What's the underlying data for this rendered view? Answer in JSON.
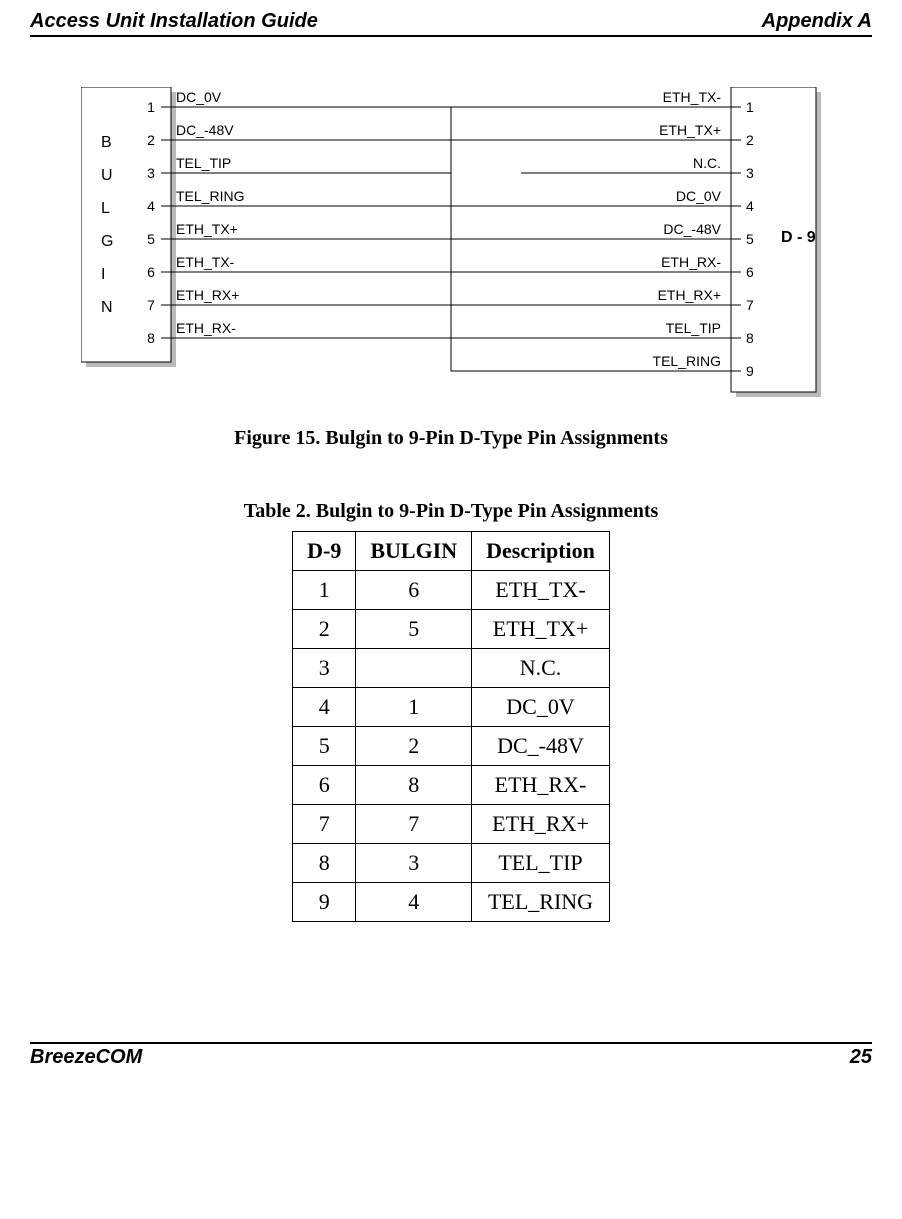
{
  "header": {
    "left": "Access Unit Installation Guide",
    "right": "Appendix A"
  },
  "footer": {
    "left": "BreezeCOM",
    "right": "25"
  },
  "diagram": {
    "left_label_letters": [
      "B",
      "U",
      "L",
      "G",
      "I",
      "N"
    ],
    "right_label": "D - 9",
    "left_pins": [
      {
        "num": "1",
        "label": "DC_0V"
      },
      {
        "num": "2",
        "label": "DC_-48V"
      },
      {
        "num": "3",
        "label": "TEL_TIP"
      },
      {
        "num": "4",
        "label": "TEL_RING"
      },
      {
        "num": "5",
        "label": "ETH_TX+"
      },
      {
        "num": "6",
        "label": "ETH_TX-"
      },
      {
        "num": "7",
        "label": "ETH_RX+"
      },
      {
        "num": "8",
        "label": "ETH_RX-"
      }
    ],
    "right_pins": [
      {
        "num": "1",
        "label": "ETH_TX-"
      },
      {
        "num": "2",
        "label": "ETH_TX+"
      },
      {
        "num": "3",
        "label": "N.C."
      },
      {
        "num": "4",
        "label": "DC_0V"
      },
      {
        "num": "5",
        "label": "DC_-48V"
      },
      {
        "num": "6",
        "label": "ETH_RX-"
      },
      {
        "num": "7",
        "label": "ETH_RX+"
      },
      {
        "num": "8",
        "label": "TEL_TIP"
      },
      {
        "num": "9",
        "label": "TEL_RING"
      }
    ]
  },
  "figure_caption": "Figure 15.  Bulgin to 9-Pin D-Type Pin Assignments",
  "table_caption": "Table 2.  Bulgin to 9-Pin D-Type Pin Assignments",
  "table": {
    "headers": [
      "D-9",
      "BULGIN",
      "Description"
    ],
    "rows": [
      [
        "1",
        "6",
        "ETH_TX-"
      ],
      [
        "2",
        "5",
        "ETH_TX+"
      ],
      [
        "3",
        "",
        "N.C."
      ],
      [
        "4",
        "1",
        "DC_0V"
      ],
      [
        "5",
        "2",
        "DC_-48V"
      ],
      [
        "6",
        "8",
        "ETH_RX-"
      ],
      [
        "7",
        "7",
        "ETH_RX+"
      ],
      [
        "8",
        "3",
        "TEL_TIP"
      ],
      [
        "9",
        "4",
        "TEL_RING"
      ]
    ]
  }
}
